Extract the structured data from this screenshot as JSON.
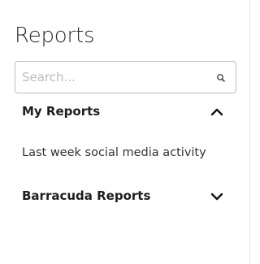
{
  "panel": {
    "title": "Reports"
  },
  "search": {
    "placeholder": "Search...",
    "value": "",
    "icon": "search-icon"
  },
  "sections": [
    {
      "label": "My Reports",
      "expanded": true,
      "icon": "chevron-up-icon",
      "items": [
        {
          "label": "Last week social media activity"
        }
      ]
    },
    {
      "label": "Barracuda Reports",
      "expanded": false,
      "icon": "chevron-down-icon",
      "items": []
    }
  ]
}
